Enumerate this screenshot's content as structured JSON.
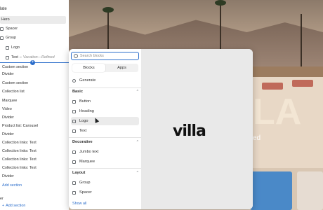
{
  "sidebar": {
    "header": "late",
    "items": [
      {
        "label": "Hero",
        "selected": true
      },
      {
        "label": "Spacer"
      },
      {
        "label": "Group"
      },
      {
        "label": "Logo"
      },
      {
        "label": "Text",
        "note": "Vacation—Refined"
      },
      {
        "label": "Custom section"
      },
      {
        "label": "Divider"
      },
      {
        "label": "Custom section"
      },
      {
        "label": "Collection list"
      },
      {
        "label": "Marquee"
      },
      {
        "label": "Video"
      },
      {
        "label": "Divider"
      },
      {
        "label": "Product list: Carousel"
      },
      {
        "label": "Divider"
      },
      {
        "label": "Collection links: Text"
      },
      {
        "label": "Collection links: Text"
      },
      {
        "label": "Collection links: Text"
      },
      {
        "label": "Collection links: Text"
      },
      {
        "label": "Divider"
      }
    ],
    "add_section": "Add section",
    "footer_label": "er",
    "footer_add_section": "Add section"
  },
  "picker": {
    "search_placeholder": "Search blocks",
    "tabs": [
      "Blocks",
      "Apps"
    ],
    "generate_label": "Generate",
    "categories": [
      {
        "label": "Basic",
        "items": [
          "Button",
          "Heading",
          "Logo",
          "Text"
        ]
      },
      {
        "label": "Decorative",
        "items": [
          "Jumbo text",
          "Marquee"
        ]
      },
      {
        "label": "Layout",
        "items": [
          "Group",
          "Spacer"
        ]
      }
    ],
    "show_all": "Show all",
    "hovered_item": "Logo",
    "preview_logo_text": "villa"
  },
  "preview": {
    "letter": "LA",
    "text": "ed"
  },
  "colors": {
    "accent": "#2c6ecb"
  }
}
